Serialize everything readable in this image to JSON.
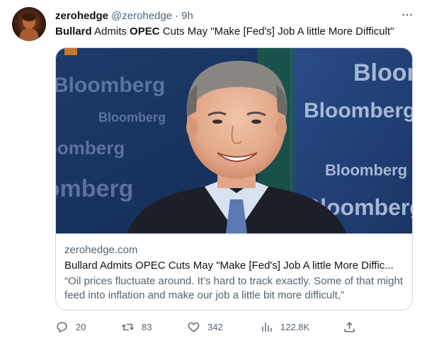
{
  "tweet": {
    "display_name": "zerohedge",
    "handle": "@zerohedge",
    "separator": "·",
    "time": "9h",
    "text_parts": [
      "Bullard",
      " Admits ",
      "OPEC",
      " Cuts May \"Make [Fed's] Job A little More Difficult\""
    ]
  },
  "card": {
    "image_alt": "Man in suit smiling in front of Bloomberg backdrop",
    "image_logo_text": "Bloomberg",
    "domain": "zerohedge.com",
    "title": "Bullard Admits OPEC Cuts May \"Make [Fed's] Job A little More Diffic...",
    "description": "“Oil prices fluctuate around. It’s hard to track exactly. Some of that might feed into inflation and make our job a little bit more difficult,”"
  },
  "actions": {
    "replies": "20",
    "retweets": "83",
    "likes": "342",
    "views": "122.8K"
  },
  "icons": [
    "more-icon",
    "reply-icon",
    "retweet-icon",
    "like-icon",
    "views-icon",
    "share-icon"
  ]
}
